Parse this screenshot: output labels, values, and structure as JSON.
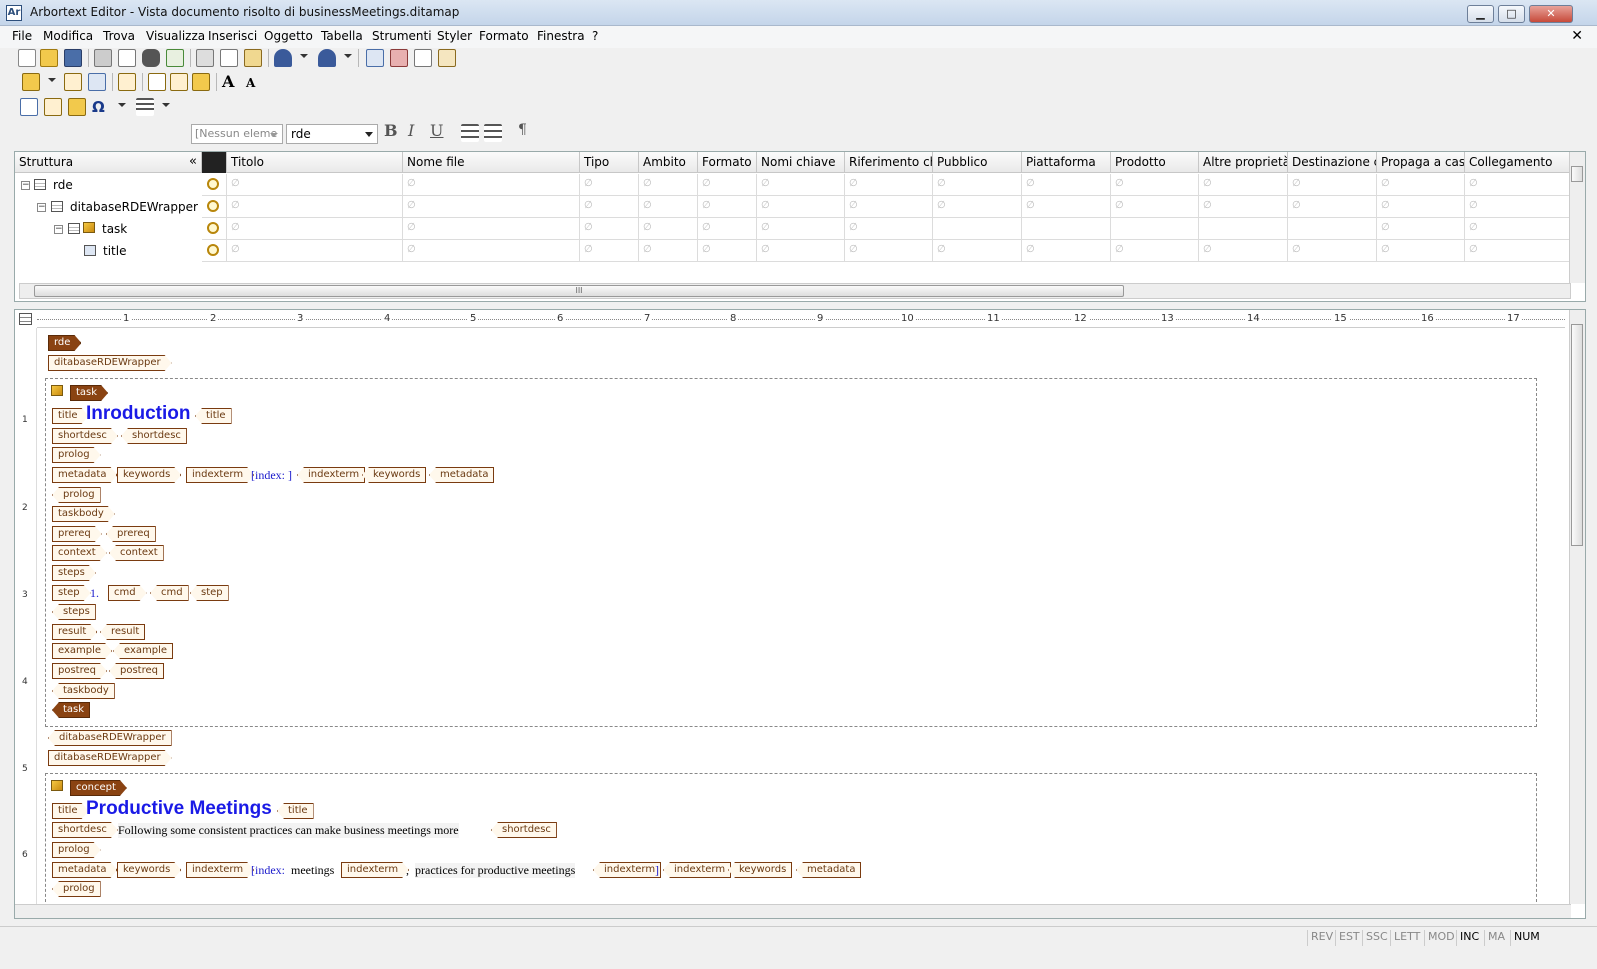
{
  "window": {
    "app_icon": "Ar",
    "title": "Arbortext Editor - Vista documento risolto di businessMeetings.ditamap",
    "controls": {
      "minimize": "▁",
      "maximize": "□",
      "close": "✕"
    }
  },
  "menu": {
    "items": [
      "File",
      "Modifica",
      "Trova",
      "Visualizza",
      "Inserisci",
      "Oggetto",
      "Tabella",
      "Strumenti",
      "Styler",
      "Formato",
      "Finestra",
      "?"
    ],
    "doc_close": "✕"
  },
  "format_bar": {
    "element_combo": "[Nessun eleme",
    "style_combo": "rde",
    "bold": "B",
    "italic": "I",
    "underline": "U",
    "pilcrow": "¶"
  },
  "map": {
    "structure_header": "Struttura",
    "collapse_glyph": "«",
    "columns": [
      "Titolo",
      "Nome file",
      "Tipo",
      "Ambito",
      "Formato",
      "Nomi chiave",
      "Riferimento chi",
      "Pubblico",
      "Piattaforma",
      "Prodotto",
      "Altre proprietà",
      "Destinazione cc",
      "Propaga a casc",
      "Collegamento"
    ],
    "rows": [
      {
        "label": "rde",
        "expander": "−"
      },
      {
        "label": "ditabaseRDEWrapper",
        "expander": "−"
      },
      {
        "label": "task",
        "expander": "−"
      },
      {
        "label": "title",
        "expander": ""
      }
    ],
    "empty_glyph": "∅",
    "scroll_grip": "III"
  },
  "ruler": {
    "numbers": [
      "1",
      "2",
      "3",
      "4",
      "5",
      "6",
      "7",
      "8",
      "9",
      "10",
      "11",
      "12",
      "13",
      "14",
      "15",
      "16",
      "17"
    ],
    "vertical_numbers": [
      "1",
      "2",
      "3",
      "4",
      "5",
      "6"
    ]
  },
  "doc": {
    "tag_rde": "rde",
    "tag_wrapper": "ditabaseRDEWrapper",
    "tag_task": "task",
    "tag_title": "title",
    "heading_task": "Inroduction",
    "tag_shortdesc": "shortdesc",
    "tag_prolog": "prolog",
    "tag_metadata": "metadata",
    "tag_keywords": "keywords",
    "tag_indexterm": "indexterm",
    "index_empty": "[index: ]",
    "tag_taskbody": "taskbody",
    "tag_prereq": "prereq",
    "tag_context": "context",
    "tag_steps": "steps",
    "tag_step": "step",
    "step_number": "1.",
    "tag_cmd": "cmd",
    "tag_result": "result",
    "tag_example": "example",
    "tag_postreq": "postreq",
    "tag_concept": "concept",
    "heading_concept": "Productive Meetings",
    "shortdesc_text": "Following some consistent practices can make business meetings more",
    "index_open": "[index:",
    "index_term1": "meetings",
    "index_sep": ",",
    "index_term2": "practices for productive meetings",
    "index_close": "]"
  },
  "status": {
    "cells": [
      "REV",
      "EST",
      "SSC",
      "LETT",
      "MOD",
      "INC",
      "MA",
      "NUM"
    ],
    "active": [
      "INC",
      "NUM"
    ]
  },
  "colors": {
    "tag_border": "#7a3b10",
    "heading": "#1a1ae6",
    "index": "#1a1acc"
  }
}
